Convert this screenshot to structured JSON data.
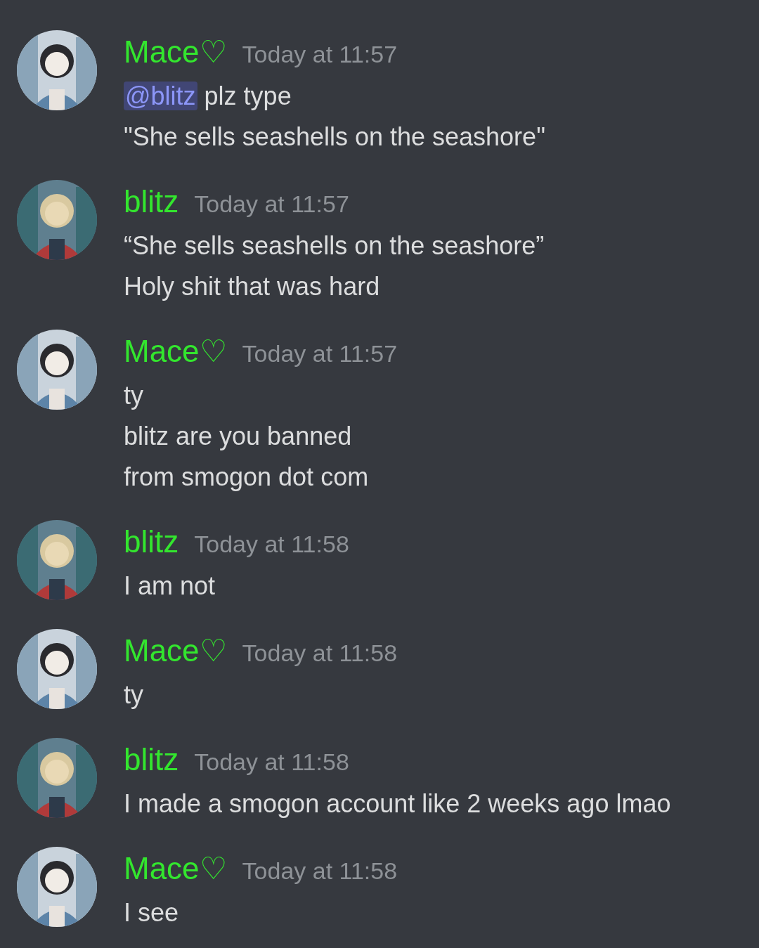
{
  "messages": [
    {
      "author": "Mace♡",
      "time": "Today at 11:57",
      "lines": [
        "**@blitz** plz type",
        "\"She sells seashells on the seashore\""
      ]
    },
    {
      "author": "blitz",
      "time": "Today at 11:57",
      "lines": [
        "“She sells seashells on the seashore”",
        "Holy shit that was hard"
      ]
    },
    {
      "author": "Mace♡",
      "time": "Today at 11:57",
      "lines": [
        "ty",
        "blitz are you banned",
        "from smogon dot com"
      ]
    },
    {
      "author": "blitz",
      "time": "Today at 11:58",
      "lines": [
        "I am not"
      ]
    },
    {
      "author": "Mace♡",
      "time": "Today at 11:58",
      "lines": [
        "ty"
      ]
    },
    {
      "author": "blitz",
      "time": "Today at 11:58",
      "lines": [
        "I made a smogon account like 2 weeks ago lmao"
      ]
    },
    {
      "author": "Mace♡",
      "time": "Today at 11:58",
      "lines": [
        "I see"
      ]
    }
  ]
}
